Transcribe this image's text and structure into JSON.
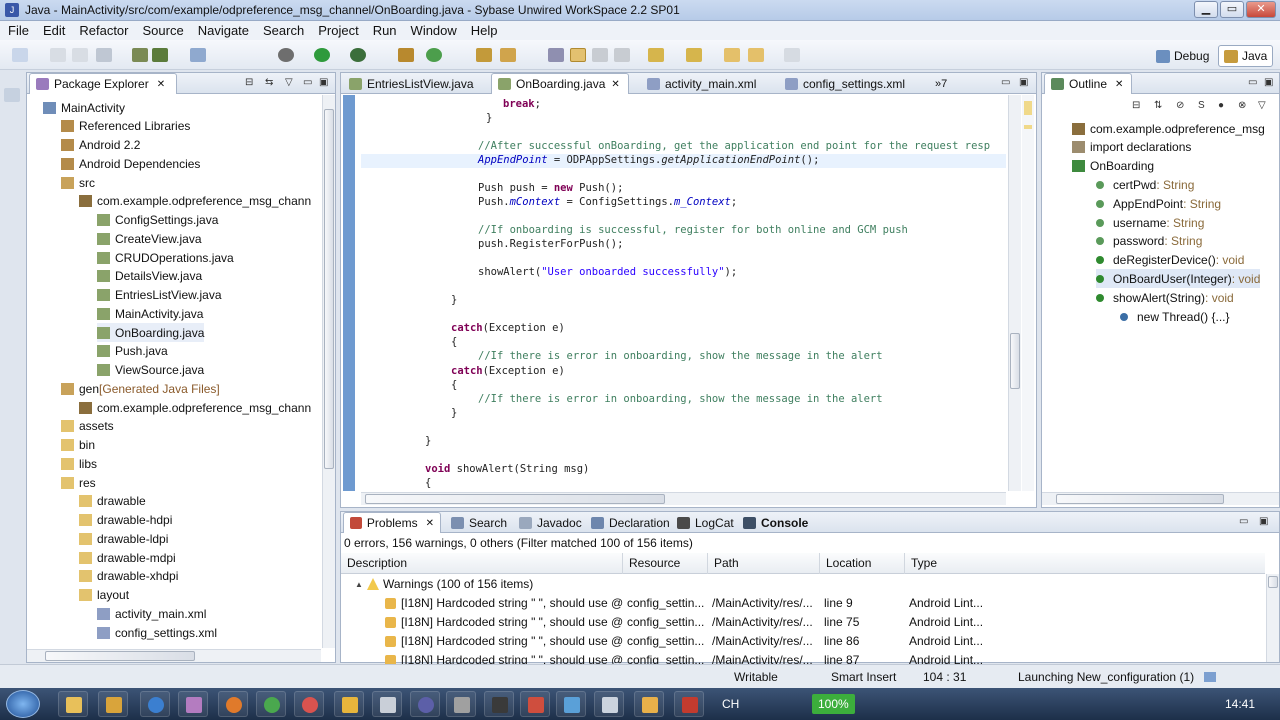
{
  "window": {
    "title": "Java - MainActivity/src/com/example/odpreference_msg_channel/OnBoarding.java - Sybase Unwired WorkSpace 2.2 SP01",
    "minimize": "▁",
    "maximize": "▭",
    "close": "✕"
  },
  "menu": [
    "File",
    "Edit",
    "Refactor",
    "Source",
    "Navigate",
    "Search",
    "Project",
    "Run",
    "Window",
    "Help"
  ],
  "perspectives": {
    "debug": "Debug",
    "java": "Java"
  },
  "package_explorer": {
    "title": "Package Explorer",
    "items": [
      {
        "label": "MainActivity",
        "level": 0,
        "icon": "project-icon"
      },
      {
        "label": "Referenced Libraries",
        "level": 1,
        "icon": "library-icon"
      },
      {
        "label": "Android 2.2",
        "level": 1,
        "icon": "library-icon"
      },
      {
        "label": "Android Dependencies",
        "level": 1,
        "icon": "library-icon"
      },
      {
        "label": "src",
        "level": 1,
        "icon": "source-folder-icon"
      },
      {
        "label": "com.example.odpreference_msg_chann",
        "level": 2,
        "icon": "package-icon"
      },
      {
        "label": "ConfigSettings.java",
        "level": 3,
        "icon": "java-file-icon"
      },
      {
        "label": "CreateView.java",
        "level": 3,
        "icon": "java-file-icon"
      },
      {
        "label": "CRUDOperations.java",
        "level": 3,
        "icon": "java-file-icon"
      },
      {
        "label": "DetailsView.java",
        "level": 3,
        "icon": "java-file-icon"
      },
      {
        "label": "EntriesListView.java",
        "level": 3,
        "icon": "java-file-icon"
      },
      {
        "label": "MainActivity.java",
        "level": 3,
        "icon": "java-file-icon"
      },
      {
        "label": "OnBoarding.java",
        "level": 3,
        "icon": "java-file-icon"
      },
      {
        "label": "Push.java",
        "level": 3,
        "icon": "java-file-icon"
      },
      {
        "label": "ViewSource.java",
        "level": 3,
        "icon": "java-file-icon"
      },
      {
        "label": "gen",
        "suffix": " [Generated Java Files]",
        "level": 1,
        "icon": "source-folder-icon"
      },
      {
        "label": "com.example.odpreference_msg_chann",
        "level": 2,
        "icon": "package-icon"
      },
      {
        "label": "assets",
        "level": 1,
        "icon": "folder-icon"
      },
      {
        "label": "bin",
        "level": 1,
        "icon": "folder-icon"
      },
      {
        "label": "libs",
        "level": 1,
        "icon": "folder-icon"
      },
      {
        "label": "res",
        "level": 1,
        "icon": "folder-icon"
      },
      {
        "label": "drawable",
        "level": 2,
        "icon": "folder-icon"
      },
      {
        "label": "drawable-hdpi",
        "level": 2,
        "icon": "folder-icon"
      },
      {
        "label": "drawable-ldpi",
        "level": 2,
        "icon": "folder-icon"
      },
      {
        "label": "drawable-mdpi",
        "level": 2,
        "icon": "folder-icon"
      },
      {
        "label": "drawable-xhdpi",
        "level": 2,
        "icon": "folder-icon"
      },
      {
        "label": "layout",
        "level": 2,
        "icon": "folder-icon"
      },
      {
        "label": "activity_main.xml",
        "level": 3,
        "icon": "xml-file-icon"
      },
      {
        "label": "config_settings.xml",
        "level": 3,
        "icon": "xml-file-icon"
      }
    ]
  },
  "editor": {
    "tabs": [
      "EntriesListView.java",
      "OnBoarding.java",
      "activity_main.xml",
      "config_settings.xml"
    ],
    "overflow": "»7"
  },
  "outline": {
    "title": "Outline",
    "items": [
      {
        "label": "com.example.odpreference_msg",
        "type": "",
        "level": 0,
        "icon": "package-icon"
      },
      {
        "label": "import declarations",
        "type": "",
        "level": 0,
        "icon": "imports-icon"
      },
      {
        "label": "OnBoarding",
        "type": "",
        "level": 0,
        "icon": "class-icon"
      },
      {
        "label": "certPwd",
        "type": " : String",
        "level": 1,
        "icon": "field-icon"
      },
      {
        "label": "AppEndPoint",
        "type": " : String",
        "level": 1,
        "icon": "field-icon"
      },
      {
        "label": "username",
        "type": " : String",
        "level": 1,
        "icon": "field-icon"
      },
      {
        "label": "password",
        "type": " : String",
        "level": 1,
        "icon": "field-icon"
      },
      {
        "label": "deRegisterDevice()",
        "type": " : void",
        "level": 1,
        "icon": "method-icon"
      },
      {
        "label": "OnBoardUser(Integer)",
        "type": " : void",
        "level": 1,
        "icon": "method-icon"
      },
      {
        "label": "showAlert(String)",
        "type": " : void",
        "level": 1,
        "icon": "method-icon"
      },
      {
        "label": "new Thread() {...}",
        "type": "",
        "level": 2,
        "icon": "anon-class-icon"
      }
    ]
  },
  "bottom": {
    "tabs": [
      "Problems",
      "Search",
      "Javadoc",
      "Declaration",
      "LogCat",
      "Console"
    ],
    "summary": "0 errors, 156 warnings, 0 others (Filter matched 100 of 156 items)",
    "columns": [
      "Description",
      "Resource",
      "Path",
      "Location",
      "Type"
    ],
    "group": "Warnings (100 of 156 items)",
    "rows": [
      [
        "[I18N] Hardcoded string \" \", should use @",
        "config_settin...",
        "/MainActivity/res/...",
        "line 9",
        "Android Lint..."
      ],
      [
        "[I18N] Hardcoded string \" \", should use @",
        "config_settin...",
        "/MainActivity/res/...",
        "line 75",
        "Android Lint..."
      ],
      [
        "[I18N] Hardcoded string \" \", should use @",
        "config_settin...",
        "/MainActivity/res/...",
        "line 86",
        "Android Lint..."
      ],
      [
        "[I18N] Hardcoded string \" \", should use @",
        "config_settin...",
        "/MainActivity/res/...",
        "line 87",
        "Android Lint..."
      ]
    ]
  },
  "status": {
    "writable": "Writable",
    "insert": "Smart Insert",
    "pos": "104 : 31",
    "task": "Launching New_configuration (1)"
  },
  "taskbar": {
    "battery": "100%",
    "lang": "CH",
    "time": "14:41"
  },
  "colors": {
    "accent": "#3a6ea5",
    "selection": "#d6e4f7"
  }
}
